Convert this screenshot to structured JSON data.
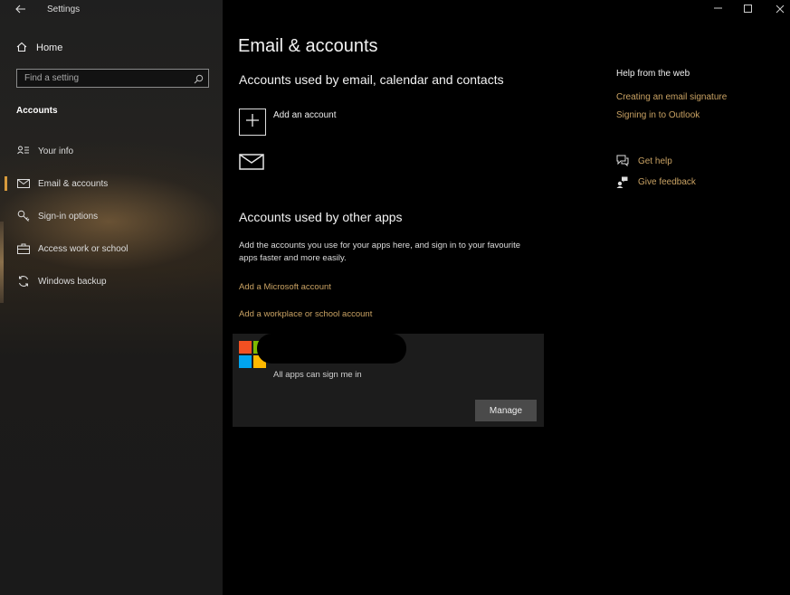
{
  "titlebar": {
    "back_icon": "back-arrow-icon",
    "title": "Settings"
  },
  "sidebar": {
    "home_label": "Home",
    "search_placeholder": "Find a setting",
    "section_label": "Accounts",
    "items": [
      {
        "label": "Your info",
        "icon": "person-card-icon"
      },
      {
        "label": "Email & accounts",
        "icon": "mail-icon",
        "active": true
      },
      {
        "label": "Sign-in options",
        "icon": "key-icon"
      },
      {
        "label": "Access work or school",
        "icon": "briefcase-icon"
      },
      {
        "label": "Windows backup",
        "icon": "sync-icon"
      }
    ],
    "accent_color": "#d79a3c"
  },
  "main": {
    "page_title": "Email & accounts",
    "section1_title": "Accounts used by email, calendar and contacts",
    "add_account_label": "Add an account",
    "section2_title": "Accounts used by other apps",
    "section2_desc": "Add the accounts you use for your apps here, and sign in to your favourite apps faster and more easily.",
    "add_microsoft_account": "Add a Microsoft account",
    "add_workplace_account": "Add a workplace or school account",
    "account_card": {
      "subtitle": "All apps can sign me in",
      "manage_label": "Manage"
    }
  },
  "help": {
    "title": "Help from the web",
    "links": [
      "Creating an email signature",
      "Signing in to Outlook"
    ],
    "get_help": "Get help",
    "give_feedback": "Give feedback",
    "link_color": "#c9a263"
  }
}
